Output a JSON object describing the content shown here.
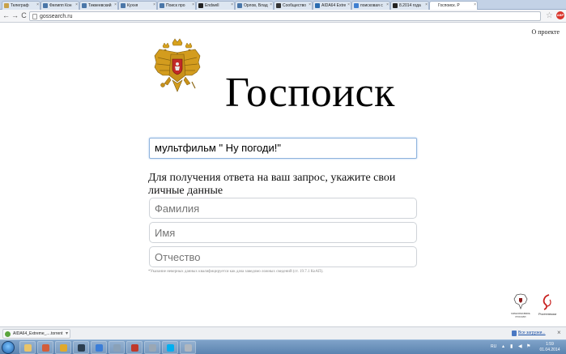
{
  "browser": {
    "tabs": [
      {
        "label": "Телеграф",
        "color": "#c8a24a",
        "active": false
      },
      {
        "label": "Филипп Кон",
        "color": "#4a76a8",
        "active": false
      },
      {
        "label": "Тиккеевский",
        "color": "#4a76a8",
        "active": false
      },
      {
        "label": "Кухня",
        "color": "#4a76a8",
        "active": false
      },
      {
        "label": "Поиск про",
        "color": "#4a76a8",
        "active": false
      },
      {
        "label": "Endwell",
        "color": "#222222",
        "active": false
      },
      {
        "label": "Орлов, Влад",
        "color": "#4a76a8",
        "active": false
      },
      {
        "label": "Сообщество",
        "color": "#333333",
        "active": false
      },
      {
        "label": "AIDA64 Extre",
        "color": "#2b6cb0",
        "active": false
      },
      {
        "label": "поисковая с",
        "color": "#3f7fd0",
        "active": false
      },
      {
        "label": "8.2014 года",
        "color": "#222222",
        "active": false
      },
      {
        "label": "Госпоиск. Р",
        "color": "#ffffff",
        "active": true
      }
    ],
    "nav": {
      "back": "←",
      "forward": "→",
      "reload": "C"
    },
    "url": "gossearch.ru",
    "star": "☆",
    "abp_label": "ABP"
  },
  "page": {
    "about_link": "О проекте",
    "logo_text": "Госпоиск",
    "search_value": "мультфильм \" Ну погоди!\"",
    "prompt": "Для получения ответа на ваш запрос, укажите свои личные данные",
    "fields": {
      "surname_placeholder": "Фамилия",
      "name_placeholder": "Имя",
      "patronymic_placeholder": "Отчество"
    },
    "disclaimer": "*Указание неверных данных квалифицируется как дача заведомо ложных сведений (ст. 19.7.1 КоАП).",
    "partners": {
      "ministry_caption": "МИНКОМСВЯЗЬ РОССИИ",
      "rostelecom_caption": "Ростелеком"
    }
  },
  "downloads": {
    "item_name": "AIDA64_Extreme_....torrent",
    "all_downloads": "Все загрузки...",
    "close": "×"
  },
  "taskbar": {
    "apps": [
      {
        "name": "explorer",
        "color": "#e9c46a"
      },
      {
        "name": "media",
        "color": "#d35d3a"
      },
      {
        "name": "chrome",
        "color": "#e0a92c"
      },
      {
        "name": "steam",
        "color": "#2c3e50"
      },
      {
        "name": "flash",
        "color": "#3a7dd8"
      },
      {
        "name": "tool",
        "color": "#8aa1b8"
      },
      {
        "name": "app-red",
        "color": "#c0392b"
      },
      {
        "name": "settings",
        "color": "#9aa7b4"
      },
      {
        "name": "skype",
        "color": "#00aff0"
      },
      {
        "name": "disk",
        "color": "#b0b7bf"
      }
    ],
    "lang": "RU",
    "time": "1:59",
    "date": "01.04.2014"
  }
}
